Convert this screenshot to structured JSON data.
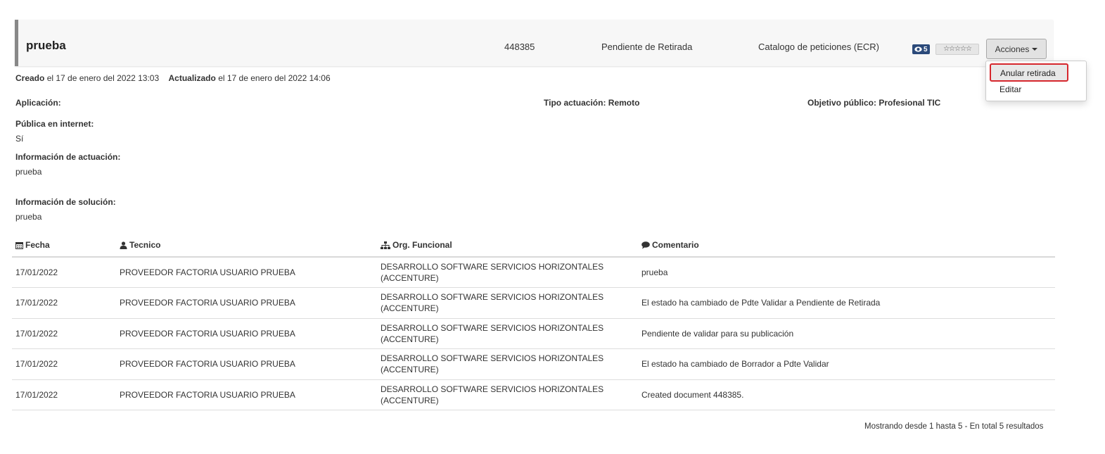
{
  "header": {
    "title": "prueba",
    "id": "448385",
    "status": "Pendiente de Retirada",
    "catalog": "Catalogo de peticiones (ECR)",
    "views": "5",
    "rating_stars": "☆☆☆☆☆",
    "actions_label": "Acciones"
  },
  "dropdown": {
    "items": [
      "Anular retirada",
      "Editar"
    ]
  },
  "meta": {
    "created_label": "Creado",
    "created_value": "el 17 de enero del 2022 13:03",
    "updated_label": "Actualizado",
    "updated_value": "el 17 de enero del 2022 14:06"
  },
  "fields": {
    "aplicacion_label": "Aplicación:",
    "tipo_actuacion": "Tipo actuación: Remoto",
    "objetivo_publico": "Objetivo público: Profesional TIC",
    "publica_label": "Pública en internet:",
    "publica_value": "Sí",
    "info_actuacion_label": "Información de actuación:",
    "info_actuacion_value": "prueba",
    "info_solucion_label": "Información de solución:",
    "info_solucion_value": "prueba"
  },
  "table": {
    "headers": [
      "Fecha",
      "Tecnico",
      "Org. Funcional",
      "Comentario"
    ],
    "rows": [
      {
        "fecha": "17/01/2022",
        "tecnico": "PROVEEDOR FACTORIA USUARIO PRUEBA",
        "org": "DESARROLLO SOFTWARE SERVICIOS HORIZONTALES (ACCENTURE)",
        "comentario": "prueba"
      },
      {
        "fecha": "17/01/2022",
        "tecnico": "PROVEEDOR FACTORIA USUARIO PRUEBA",
        "org": "DESARROLLO SOFTWARE SERVICIOS HORIZONTALES (ACCENTURE)",
        "comentario": "El estado ha cambiado de Pdte Validar a Pendiente de Retirada"
      },
      {
        "fecha": "17/01/2022",
        "tecnico": "PROVEEDOR FACTORIA USUARIO PRUEBA",
        "org": "DESARROLLO SOFTWARE SERVICIOS HORIZONTALES (ACCENTURE)",
        "comentario": "Pendiente de validar para su publicación"
      },
      {
        "fecha": "17/01/2022",
        "tecnico": "PROVEEDOR FACTORIA USUARIO PRUEBA",
        "org": "DESARROLLO SOFTWARE SERVICIOS HORIZONTALES (ACCENTURE)",
        "comentario": "El estado ha cambiado de Borrador a Pdte Validar"
      },
      {
        "fecha": "17/01/2022",
        "tecnico": "PROVEEDOR FACTORIA USUARIO PRUEBA",
        "org": "DESARROLLO SOFTWARE SERVICIOS HORIZONTALES (ACCENTURE)",
        "comentario": "Created document 448385."
      }
    ]
  },
  "footer": {
    "count_text": "Mostrando desde 1 hasta 5 - En total 5 resultados"
  },
  "icons": {
    "views": "eye-icon",
    "fecha": "calendar-icon",
    "tecnico": "user-icon",
    "org": "sitemap-icon",
    "comentario": "comment-icon"
  },
  "colors": {
    "highlight_border": "#d6272d",
    "views_badge": "#2b4a7a"
  }
}
